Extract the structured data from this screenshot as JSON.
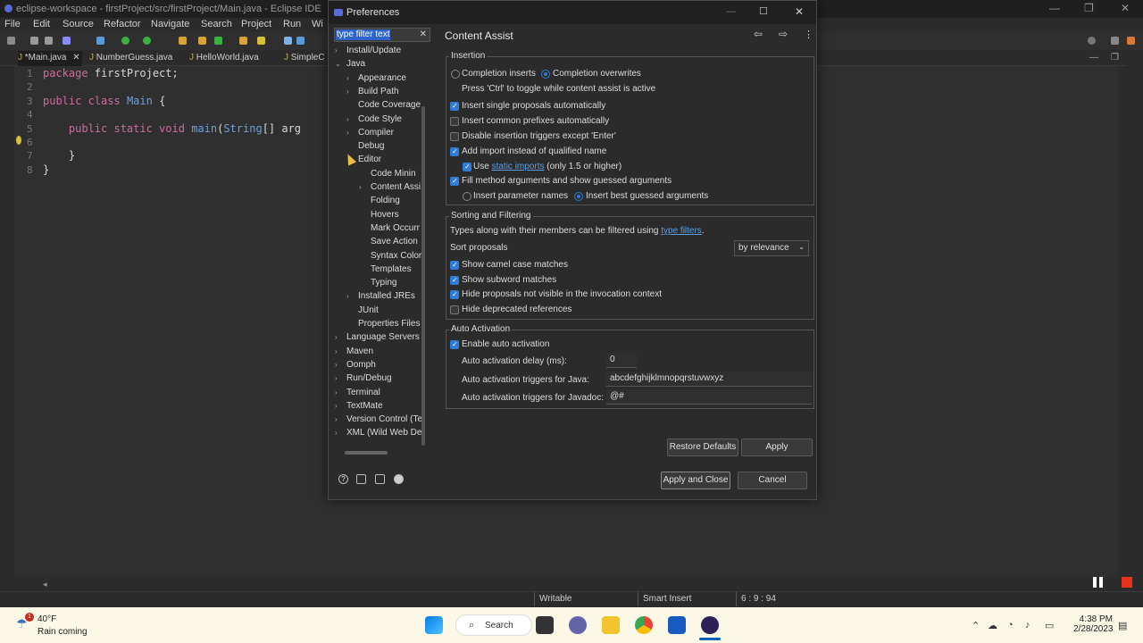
{
  "window": {
    "title": "eclipse-workspace - firstProject/src/firstProject/Main.java - Eclipse IDE",
    "menu": [
      "File",
      "Edit",
      "Source",
      "Refactor",
      "Navigate",
      "Search",
      "Project",
      "Run",
      "Wi"
    ]
  },
  "editor_tabs": [
    "*Main.java",
    "NumberGuess.java",
    "HelloWorld.java",
    "SimpleC"
  ],
  "code_lines": [
    {
      "n": "1",
      "text": "package firstProject;"
    },
    {
      "n": "2",
      "text": ""
    },
    {
      "n": "3",
      "text": "public class Main {"
    },
    {
      "n": "4",
      "text": ""
    },
    {
      "n": "5",
      "text": "    public static void main(String[] arg"
    },
    {
      "n": "6",
      "text": ""
    },
    {
      "n": "7",
      "text": "    }"
    },
    {
      "n": "8",
      "text": "}"
    }
  ],
  "status": {
    "mode": "Writable",
    "insert": "Smart Insert",
    "position": "6 : 9 : 94"
  },
  "dialog": {
    "title": "Preferences",
    "filter_text": "type filter text",
    "page_title": "Content Assist",
    "tree": [
      {
        "label": "Install/Update",
        "level": 0,
        "arrow": "›"
      },
      {
        "label": "Java",
        "level": 0,
        "arrow": "⌄"
      },
      {
        "label": "Appearance",
        "level": 1,
        "arrow": "›"
      },
      {
        "label": "Build Path",
        "level": 1,
        "arrow": "›"
      },
      {
        "label": "Code Coverage",
        "level": 1,
        "arrow": ""
      },
      {
        "label": "Code Style",
        "level": 1,
        "arrow": "›"
      },
      {
        "label": "Compiler",
        "level": 1,
        "arrow": "›"
      },
      {
        "label": "Debug",
        "level": 1,
        "arrow": ""
      },
      {
        "label": "Editor",
        "level": 1,
        "arrow": ""
      },
      {
        "label": "Code Minin",
        "level": 2,
        "arrow": ""
      },
      {
        "label": "Content Assi",
        "level": 2,
        "arrow": "›"
      },
      {
        "label": "Folding",
        "level": 2,
        "arrow": ""
      },
      {
        "label": "Hovers",
        "level": 2,
        "arrow": ""
      },
      {
        "label": "Mark Occurr",
        "level": 2,
        "arrow": ""
      },
      {
        "label": "Save Action",
        "level": 2,
        "arrow": ""
      },
      {
        "label": "Syntax Color",
        "level": 2,
        "arrow": ""
      },
      {
        "label": "Templates",
        "level": 2,
        "arrow": ""
      },
      {
        "label": "Typing",
        "level": 2,
        "arrow": ""
      },
      {
        "label": "Installed JREs",
        "level": 1,
        "arrow": "›"
      },
      {
        "label": "JUnit",
        "level": 1,
        "arrow": ""
      },
      {
        "label": "Properties Files",
        "level": 1,
        "arrow": ""
      },
      {
        "label": "Language Servers",
        "level": 0,
        "arrow": "›"
      },
      {
        "label": "Maven",
        "level": 0,
        "arrow": "›"
      },
      {
        "label": "Oomph",
        "level": 0,
        "arrow": "›"
      },
      {
        "label": "Run/Debug",
        "level": 0,
        "arrow": "›"
      },
      {
        "label": "Terminal",
        "level": 0,
        "arrow": "›"
      },
      {
        "label": "TextMate",
        "level": 0,
        "arrow": "›"
      },
      {
        "label": "Version Control (Te",
        "level": 0,
        "arrow": "›"
      },
      {
        "label": "XML (Wild Web De",
        "level": 0,
        "arrow": "›"
      }
    ],
    "insertion": {
      "label": "Insertion",
      "completion_inserts": "Completion inserts",
      "completion_overwrites": "Completion overwrites",
      "toggle_hint": "Press 'Ctrl' to toggle while content assist is active",
      "single_proposals": "Insert single proposals automatically",
      "common_prefixes": "Insert common prefixes automatically",
      "disable_triggers": "Disable insertion triggers except 'Enter'",
      "add_import": "Add import instead of qualified name",
      "use_static_pre": "Use",
      "use_static_link": "static imports",
      "use_static_post": "(only 1.5 or higher)",
      "fill_method": "Fill method arguments and show guessed arguments",
      "insert_param_names": "Insert parameter names",
      "insert_best_guessed": "Insert best guessed arguments"
    },
    "sorting": {
      "label": "Sorting and Filtering",
      "types_pre": "Types along with their members can be filtered using",
      "types_link": "type filters",
      "types_post": ".",
      "sort_label": "Sort proposals",
      "sort_value": "by relevance",
      "camel_case": "Show camel case matches",
      "subword": "Show subword matches",
      "hide_not_visible": "Hide proposals not visible in the invocation context",
      "hide_deprecated": "Hide deprecated references"
    },
    "auto": {
      "label": "Auto Activation",
      "enable": "Enable auto activation",
      "delay_label": "Auto activation delay (ms):",
      "delay_value": "0",
      "java_label": "Auto activation triggers for Java:",
      "java_value": "abcdefghijklmnopqrstuvwxyz",
      "javadoc_label": "Auto activation triggers for Javadoc:",
      "javadoc_value": "@#"
    },
    "buttons": {
      "restore": "Restore Defaults",
      "apply": "Apply",
      "apply_close": "Apply and Close",
      "cancel": "Cancel"
    }
  },
  "taskbar": {
    "temp": "40°F",
    "weather": "Rain coming",
    "weather_badge": "1",
    "search": "Search",
    "time": "4:38 PM",
    "date": "2/28/2023"
  }
}
